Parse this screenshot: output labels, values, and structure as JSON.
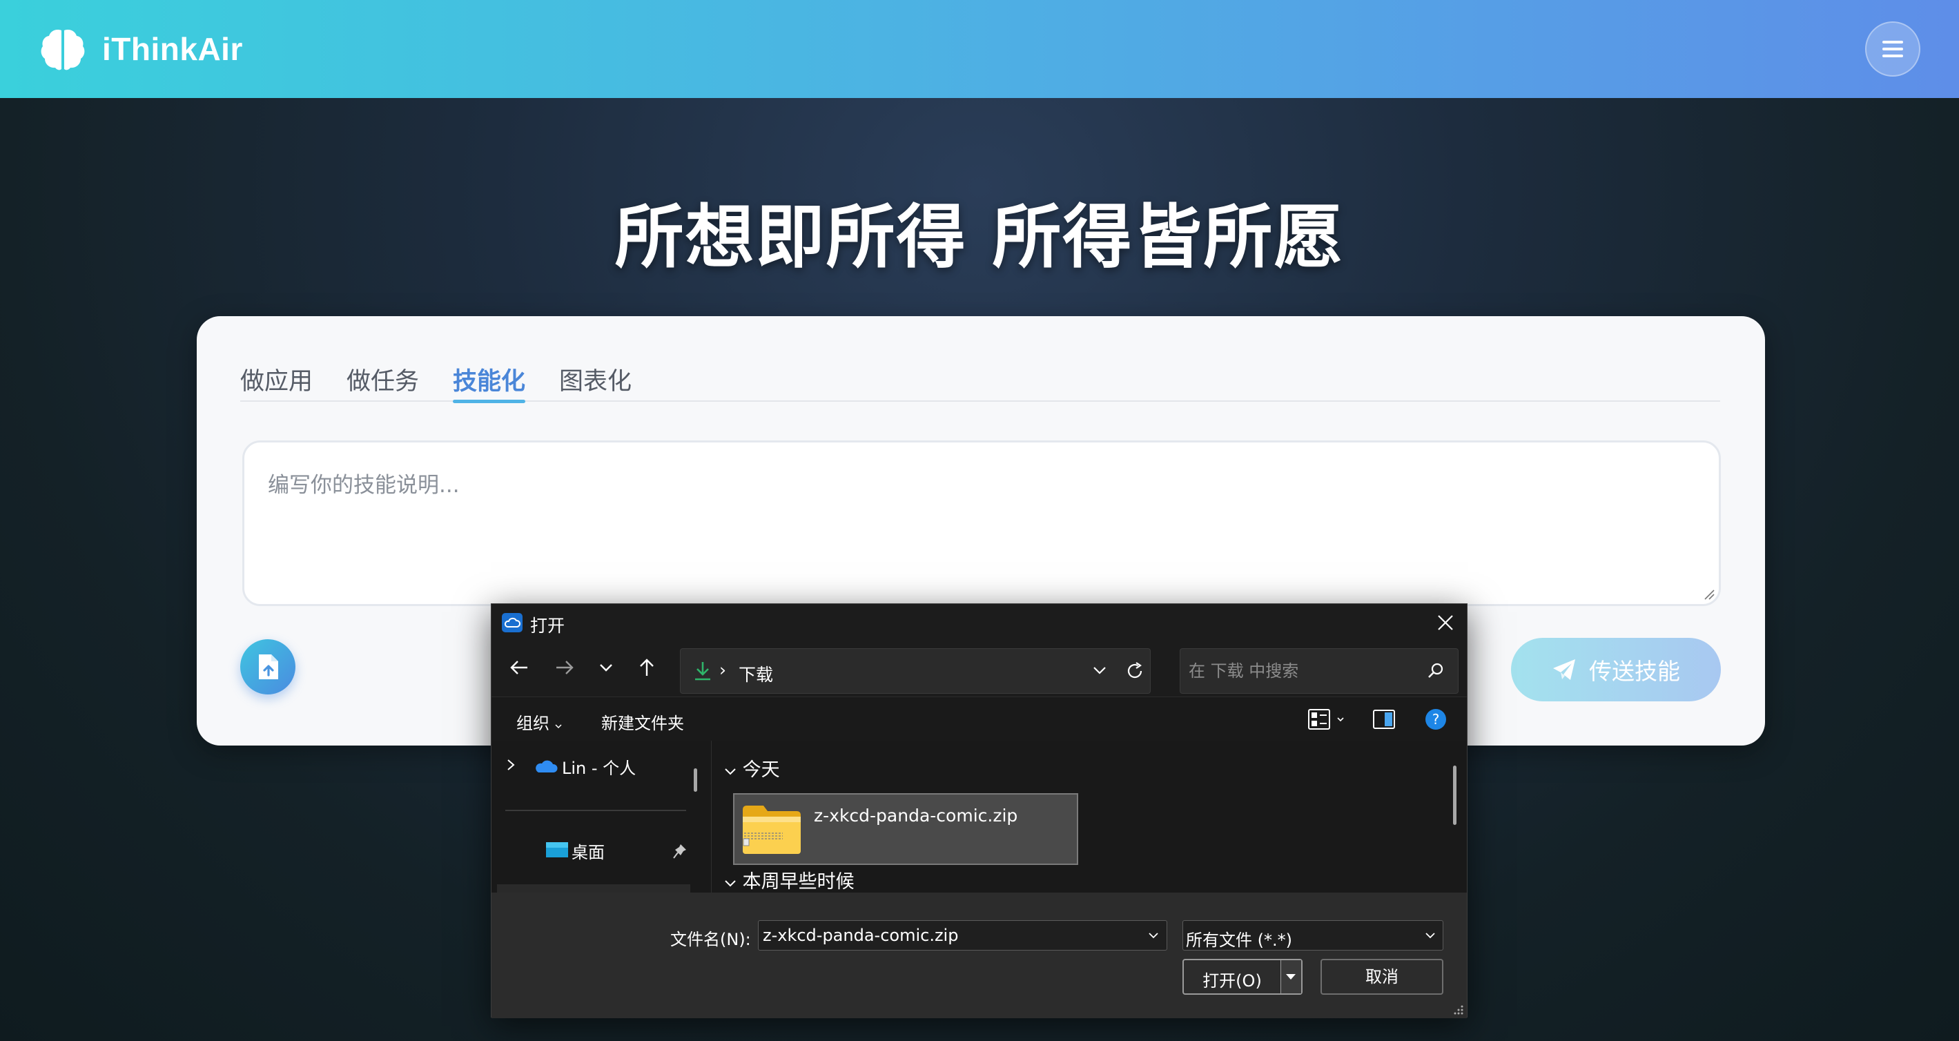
{
  "header": {
    "brand_name": "iThinkAir",
    "brand_icon": "brain-icon",
    "menu_icon": "hamburger-icon",
    "gradient_start": "#3ad0dc",
    "gradient_end": "#5e8ee8"
  },
  "hero": {
    "title": "所想即所得 所得皆所愿"
  },
  "card": {
    "tabs": [
      {
        "label": "做应用",
        "active": false
      },
      {
        "label": "做任务",
        "active": false
      },
      {
        "label": "技能化",
        "active": true
      },
      {
        "label": "图表化",
        "active": false
      }
    ],
    "prompt_placeholder": "编写你的技能说明...",
    "prompt_value": "",
    "upload_icon": "file-upload-icon",
    "send_label": "传送技能",
    "send_icon": "paper-plane-icon",
    "accent_color": "#4a86d8"
  },
  "dialog": {
    "title": "打开",
    "address": {
      "separator": "›",
      "location": "下载"
    },
    "search_placeholder": "在 下载 中搜索",
    "commands": {
      "organize": "组织",
      "new_folder": "新建文件夹"
    },
    "nav_pane": {
      "onedrive": "Lin - 个人",
      "desktop": "桌面"
    },
    "groups": {
      "today": "今天",
      "earlier_this_week": "本周早些时候"
    },
    "files": [
      {
        "name": "z-xkcd-panda-comic.zip",
        "icon": "zip-folder-icon",
        "selected": true
      }
    ],
    "file_name_label": "文件名(N):",
    "file_name_value": "z-xkcd-panda-comic.zip",
    "file_type": "所有文件 (*.*)",
    "open_label": "打开(O)",
    "cancel_label": "取消"
  }
}
